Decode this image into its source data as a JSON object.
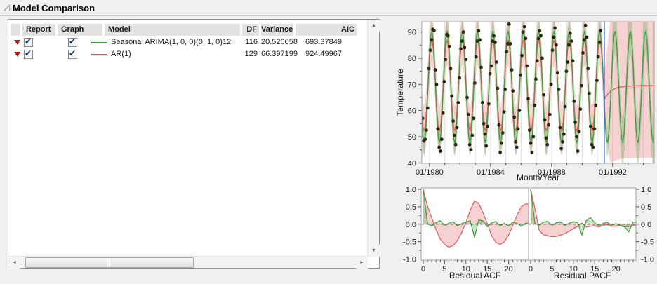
{
  "window": {
    "title": "Model Comparison"
  },
  "icons": {
    "check": "✔",
    "scroll_up": "▲",
    "scroll_down": "▼",
    "scroll_left": "◄",
    "scroll_right": "►"
  },
  "colors": {
    "arima_green": "#3c9e3c",
    "ar1_red": "#e0585d",
    "green_band": "rgba(60,158,60,0.28)",
    "pink_band": "rgba(224,88,93,0.28)",
    "data_dot": "#2b2517",
    "forecast_divider_blue": "#3465d0",
    "grid": "#dedede",
    "plot_border": "#a0a0a0"
  },
  "table": {
    "headers": {
      "report": "Report",
      "graph": "Graph",
      "model": "Model",
      "df": "DF",
      "variance": "Variance",
      "aic": "AIC"
    },
    "rows": [
      {
        "report_checked": true,
        "graph_checked": true,
        "color": "#3c9e3c",
        "model": "Seasonal ARIMA(1, 0, 0)(0, 1, 0)12",
        "df": "116",
        "variance": "20.520058",
        "aic": "693.37849"
      },
      {
        "report_checked": true,
        "graph_checked": true,
        "color": "#e0585d",
        "model": "AR(1)",
        "df": "129",
        "variance": "66.397199",
        "aic": "924.49967"
      }
    ]
  },
  "chart_data": [
    {
      "type": "line",
      "xlabel": "Month/Year",
      "ylabel": "Temperature",
      "ylim": [
        40,
        94
      ],
      "xlim": [
        1979.5,
        1994.77
      ],
      "y_ticks": [
        40,
        50,
        60,
        70,
        80,
        90
      ],
      "x_ticks": [
        {
          "t": 1980,
          "label": "01/1980"
        },
        {
          "t": 1984,
          "label": "01/1984"
        },
        {
          "t": 1988,
          "label": "01/1988"
        },
        {
          "t": 1992,
          "label": "01/1992"
        }
      ],
      "minor_x_tick_step_years": 1,
      "grid": "vertical-yearly",
      "forecast_start": 1991.45,
      "observed": {
        "name": "Temperature (monthly)",
        "start": 1979.55,
        "step": 0.0833333,
        "values": [
          57,
          48.5,
          49,
          52.5,
          61,
          76,
          83,
          87,
          91,
          90.5,
          75.5,
          70,
          53,
          46,
          44.5,
          49,
          59,
          71,
          79.5,
          89,
          88.5,
          84.5,
          76,
          65.5,
          56,
          50.5,
          47,
          53.5,
          63,
          72.5,
          83.5,
          86.5,
          90,
          84,
          79.5,
          65,
          58.5,
          47,
          45,
          50.5,
          57,
          70.5,
          80.5,
          86.5,
          90.5,
          87,
          76.5,
          63,
          55,
          51,
          46.5,
          54,
          62.5,
          74,
          77,
          86.5,
          88.5,
          86,
          78.5,
          68.5,
          54.5,
          44,
          47.5,
          51.5,
          59.5,
          68,
          82.5,
          85.5,
          93,
          85.5,
          75.5,
          67.5,
          57.5,
          48,
          46,
          53,
          60,
          73.5,
          81,
          90,
          92,
          87.5,
          77,
          64.5,
          52.5,
          47.5,
          44,
          50,
          62,
          72,
          79,
          87.5,
          90.5,
          88.5,
          80,
          66,
          56.5,
          49.5,
          47,
          54.5,
          58.5,
          70,
          83,
          88,
          91.5,
          85,
          74.5,
          68,
          53.5,
          45.5,
          48,
          51,
          61.5,
          75,
          78.5,
          85,
          89.5,
          86.5,
          79,
          63.5,
          55.5,
          50,
          44.5,
          52,
          60.5,
          69.5,
          82,
          87,
          92.5,
          88,
          76,
          66.5,
          54,
          47,
          46,
          53,
          62,
          71.5,
          80.5,
          86,
          90.5
        ]
      },
      "models": [
        {
          "name": "Seasonal ARIMA(1, 0, 0)(0, 1, 0)12",
          "color": "#3c9e3c",
          "band_color": "rgba(60,158,60,0.28)",
          "mean": 69,
          "amplitude": 21.5,
          "peak_phase": 0.15,
          "ci_halfwidth": 4.5,
          "ci_halfwidth_forecast": 9,
          "forecast_behavior": "seasonal oscillation continues"
        },
        {
          "name": "AR(1)",
          "color": "#e0585d",
          "band_color": "rgba(224,88,93,0.28)",
          "mean": 69.5,
          "amplitude": 17.5,
          "peak_phase": 0.15,
          "ci_halfwidth": 9.5,
          "ci_halfwidth_forecast": 27.5,
          "forecast_behavior": "decays to mean ~69.5"
        }
      ]
    },
    {
      "type": "area",
      "title": "Residual ACF",
      "ylim": [
        -1,
        1
      ],
      "y_ticks": [
        1.0,
        0.5,
        0.0,
        -0.5,
        -1.0
      ],
      "y_axis_side": "left",
      "x_tick_labels": [
        0,
        5,
        10,
        15,
        20
      ],
      "lag_max": 24,
      "series": [
        {
          "name": "Seasonal ARIMA(1, 0, 0)(0, 1, 0)12",
          "color": "#3c9e3c",
          "fill": "rgba(60,158,60,0.28)",
          "values": [
            1,
            0.02,
            -0.06,
            0.05,
            0.1,
            -0.04,
            0.03,
            0.07,
            -0.05,
            0.02,
            0.06,
            0.1,
            -0.38,
            0.13,
            0.09,
            -0.07,
            0.04,
            0.08,
            -0.05,
            0.03,
            -0.05,
            0.06,
            0.02,
            -0.06,
            0.03
          ]
        },
        {
          "name": "AR(1)",
          "color": "#e0585d",
          "fill": "rgba(224,88,93,0.28)",
          "values": [
            1,
            0.52,
            0.17,
            -0.16,
            -0.43,
            -0.58,
            -0.66,
            -0.61,
            -0.47,
            -0.24,
            0.05,
            0.4,
            0.67,
            0.6,
            0.33,
            0.02,
            -0.32,
            -0.52,
            -0.58,
            -0.51,
            -0.31,
            -0.03,
            0.27,
            0.5,
            0.58
          ]
        }
      ]
    },
    {
      "type": "area",
      "title": "Residual PACF",
      "ylim": [
        -1,
        1
      ],
      "y_ticks": [
        1.0,
        0.5,
        0.0,
        -0.5,
        -1.0
      ],
      "y_axis_side": "right",
      "x_tick_labels": [
        0,
        5,
        10,
        15,
        20
      ],
      "lag_max": 24,
      "series": [
        {
          "name": "Seasonal ARIMA(1, 0, 0)(0, 1, 0)12",
          "color": "#3c9e3c",
          "fill": "rgba(60,158,60,0.28)",
          "values": [
            1,
            0.03,
            -0.04,
            0.06,
            0.08,
            -0.03,
            0.04,
            0.06,
            -0.04,
            0.03,
            0.07,
            0.05,
            -0.31,
            0.1,
            0.19,
            0.04,
            -0.05,
            0.03,
            0.05,
            -0.03,
            0.02,
            -0.04,
            -0.08,
            -0.22,
            0.06
          ]
        },
        {
          "name": "AR(1)",
          "color": "#e0585d",
          "fill": "rgba(224,88,93,0.28)",
          "values": [
            1,
            0.45,
            -0.18,
            -0.3,
            -0.33,
            -0.36,
            -0.35,
            -0.31,
            -0.27,
            -0.2,
            -0.13,
            -0.06,
            0.03,
            -0.08,
            -0.06,
            -0.04,
            -0.08,
            -0.03,
            -0.02,
            -0.06,
            -0.05,
            -0.04,
            -0.08,
            -0.07,
            -0.03
          ]
        }
      ]
    }
  ]
}
